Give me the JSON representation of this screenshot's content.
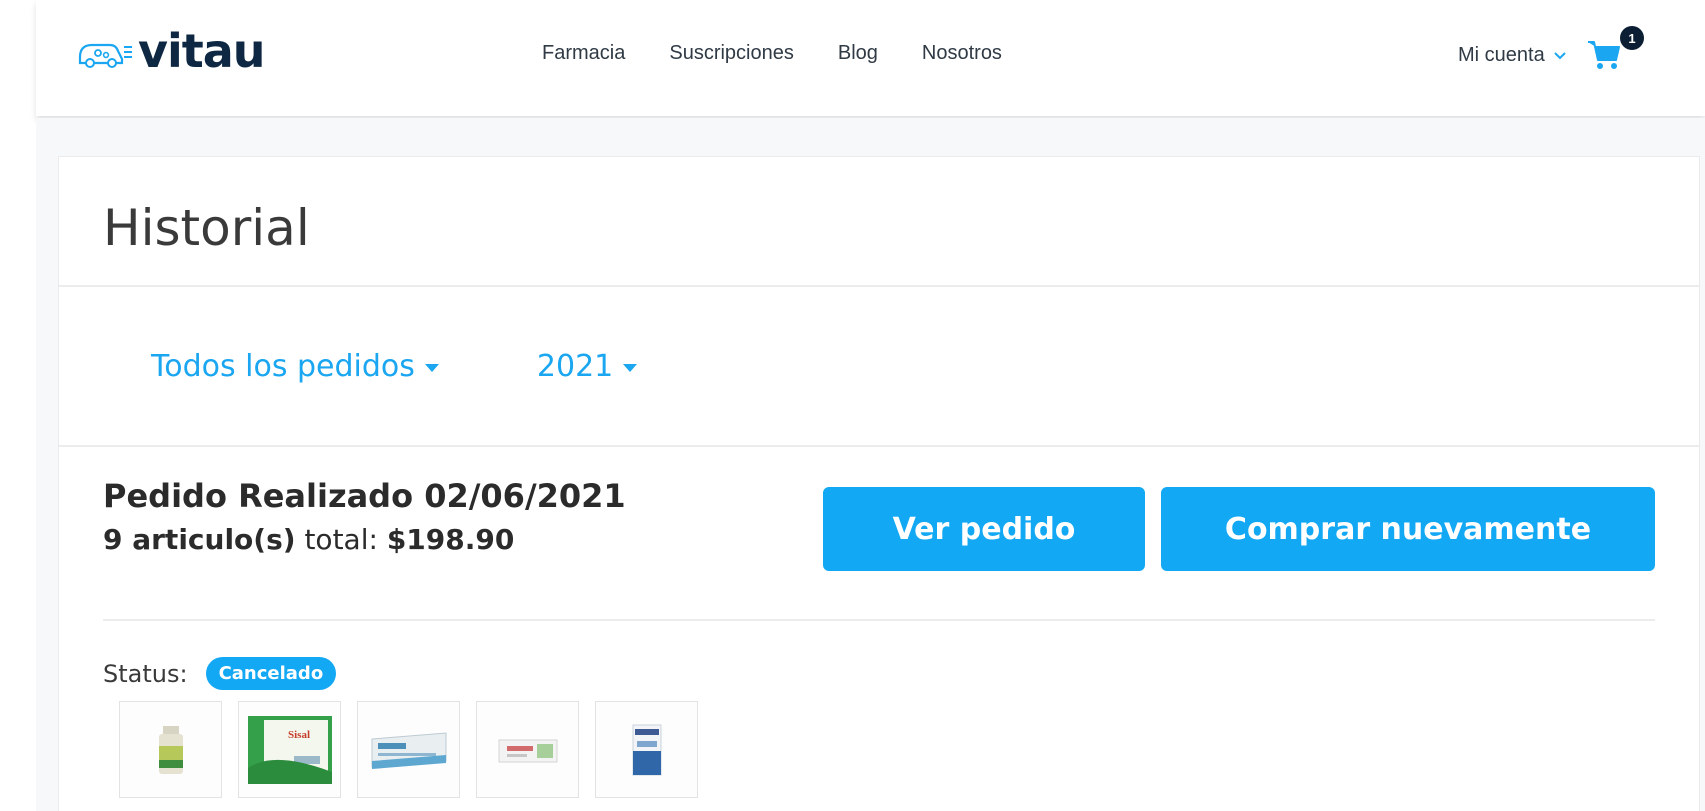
{
  "brand": {
    "name": "vitau"
  },
  "nav": {
    "items": [
      "Farmacia",
      "Suscripciones",
      "Blog",
      "Nosotros"
    ]
  },
  "account": {
    "label": "Mi cuenta",
    "cart_count": "1"
  },
  "page": {
    "title": "Historial"
  },
  "filters": {
    "orders": "Todos los pedidos",
    "year": "2021"
  },
  "order": {
    "placed": "Pedido Realizado 02/06/2021",
    "items": "9 articulo(s)",
    "total_label": "total:",
    "total": "$198.90",
    "view_label": "Ver pedido",
    "buy_again_label": "Comprar nuevamente",
    "status_label": "Status:",
    "status": "Cancelado",
    "products": [
      "product-bottle",
      "product-green-box",
      "product-blue-box",
      "product-white-box",
      "product-blue-pack"
    ]
  },
  "colors": {
    "accent": "#13a8f4",
    "brand_dark": "#0e2742",
    "link": "#1aa6f0"
  }
}
